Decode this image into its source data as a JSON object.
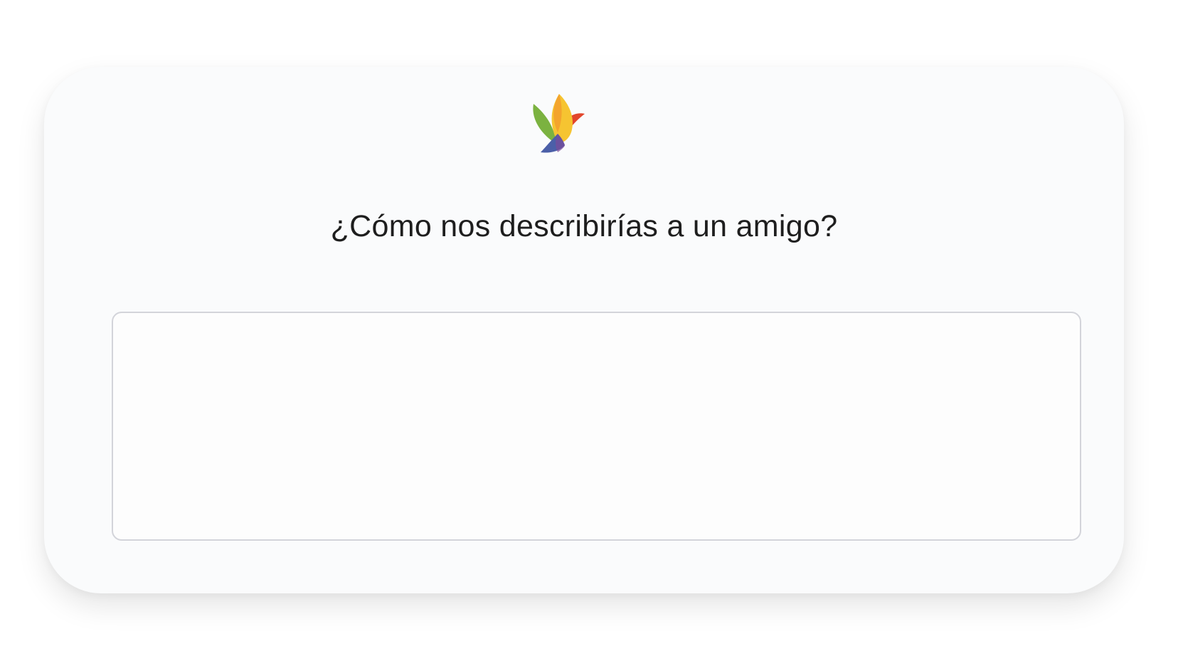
{
  "survey": {
    "logo_icon": "bird-logo-icon",
    "question": "¿Cómo nos describirías a un amigo?",
    "answer_value": "",
    "answer_placeholder": ""
  },
  "colors": {
    "card_background": "#fafbfc",
    "page_background": "#ffffff",
    "input_border": "#d3d4da",
    "text": "#1e1e1e",
    "logo_green": "#7bb240",
    "logo_yellow": "#f6c431",
    "logo_red": "#e2462c",
    "logo_blue": "#4b5fa8"
  }
}
